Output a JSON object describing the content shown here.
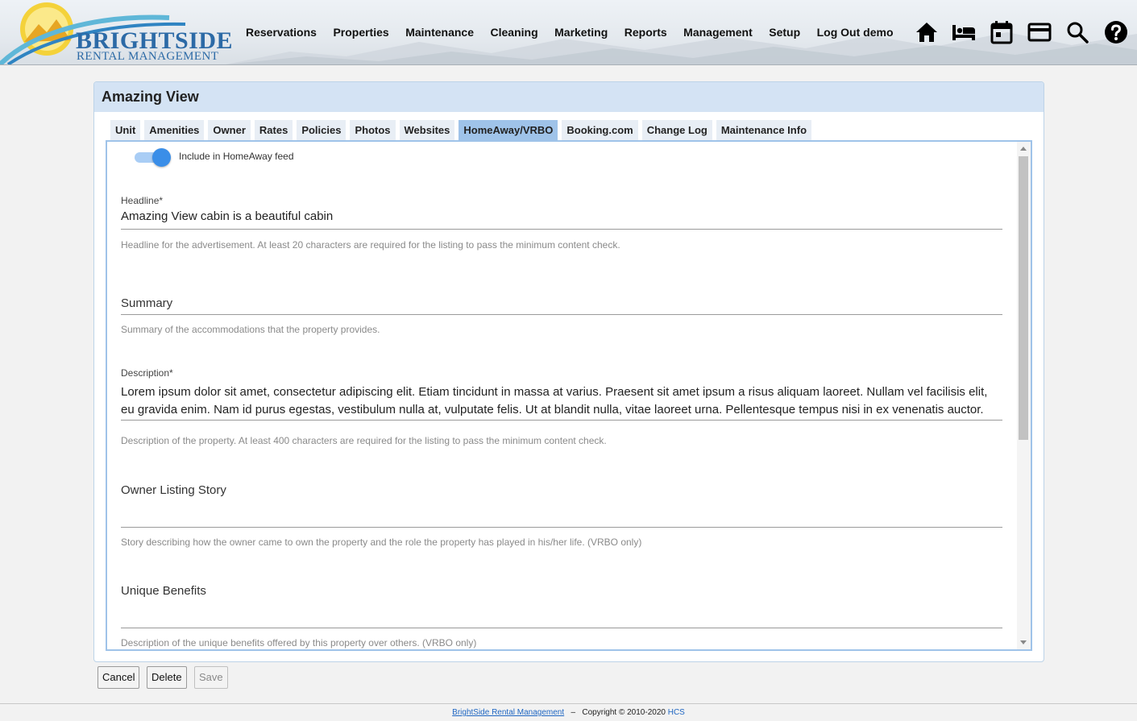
{
  "app": {
    "logo_line1": "BRIGHTSIDE",
    "logo_line2": "RENTAL MANAGEMENT"
  },
  "nav": {
    "items": [
      "Reservations",
      "Properties",
      "Maintenance",
      "Cleaning",
      "Marketing",
      "Reports",
      "Management",
      "Setup",
      "Log Out demo"
    ]
  },
  "header_icons": [
    "home-icon",
    "bed-icon",
    "calendar-icon",
    "credit-card-icon",
    "search-icon",
    "help-icon"
  ],
  "panel": {
    "title": "Amazing View",
    "tabs": [
      {
        "label": "Unit",
        "active": false
      },
      {
        "label": "Amenities",
        "active": false
      },
      {
        "label": "Owner",
        "active": false
      },
      {
        "label": "Rates",
        "active": false
      },
      {
        "label": "Policies",
        "active": false
      },
      {
        "label": "Photos",
        "active": false
      },
      {
        "label": "Websites",
        "active": false
      },
      {
        "label": "HomeAway/VRBO",
        "active": true
      },
      {
        "label": "Booking.com",
        "active": false
      },
      {
        "label": "Change Log",
        "active": false
      },
      {
        "label": "Maintenance Info",
        "active": false
      }
    ]
  },
  "form": {
    "feed_toggle": {
      "label": "Include in HomeAway feed",
      "on": true
    },
    "headline": {
      "label": "Headline*",
      "value": "Amazing View cabin is a beautiful cabin",
      "hint": "Headline for the advertisement. At least 20 characters are required for the listing to pass the minimum content check."
    },
    "summary": {
      "label": "Summary",
      "value": "",
      "hint": "Summary of the accommodations that the property provides."
    },
    "description": {
      "label": "Description*",
      "value": "Lorem ipsum dolor sit amet, consectetur adipiscing elit. Etiam tincidunt in massa at varius. Praesent sit amet ipsum a risus aliquam laoreet. Nullam vel facilisis elit, eu gravida enim. Nam id purus egestas, vestibulum nulla at, vulputate felis. Ut at blandit nulla, vitae laoreet urna. Pellentesque tempus nisi in ex venenatis auctor. Mauris porttitor nec tellus at tempus.",
      "hint": "Description of the property. At least 400 characters are required for the listing to pass the minimum content check."
    },
    "owner_story": {
      "label": "Owner Listing Story",
      "value": "",
      "hint": "Story describing how the owner came to own the property and the role the property has played in his/her life. (VRBO only)"
    },
    "unique_benefits": {
      "label": "Unique Benefits",
      "value": "",
      "hint": "Description of the unique benefits offered by this property over others. (VRBO only)"
    }
  },
  "buttons": {
    "cancel": "Cancel",
    "delete": "Delete",
    "save": "Save"
  },
  "footer": {
    "link": "BrightSide Rental Management",
    "separator": "–",
    "copyright": "Copyright © 2010-2020",
    "company": "HCS"
  }
}
